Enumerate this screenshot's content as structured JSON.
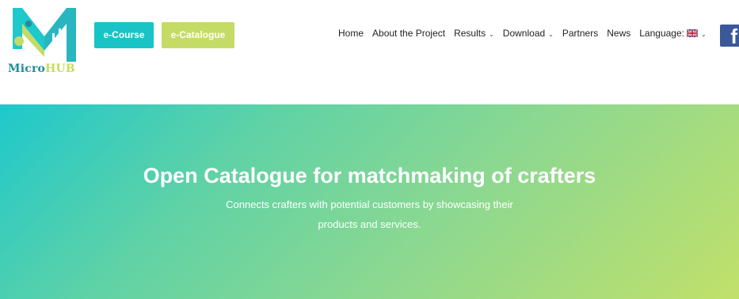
{
  "brand": {
    "name_part1": "Micro",
    "name_part2": "HUB"
  },
  "header_buttons": {
    "course": "e-Course",
    "catalogue": "e-Catalogue"
  },
  "nav": {
    "home": "Home",
    "about": "About the Project",
    "results": "Results",
    "download": "Download",
    "partners": "Partners",
    "news": "News",
    "language": "Language:"
  },
  "social": {
    "facebook_glyph": "f"
  },
  "hero": {
    "title": "Open Catalogue for matchmaking of crafters",
    "subtitle_line1": "Connects crafters with potential customers by showcasing their",
    "subtitle_line2": "products and services."
  },
  "colors": {
    "teal": "#19c3c6",
    "lime": "#c4dc66",
    "facebook": "#3b5998"
  },
  "icons": [
    "microhub-logo",
    "chevron-down-icon",
    "uk-flag-icon",
    "facebook-icon"
  ]
}
